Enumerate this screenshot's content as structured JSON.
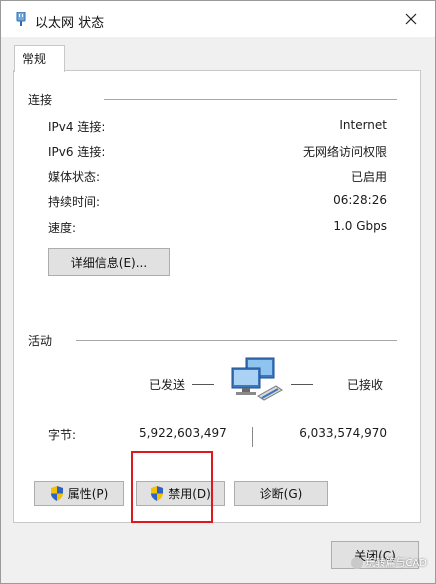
{
  "window": {
    "title": "以太网 状态"
  },
  "tabs": [
    {
      "label": "常规"
    }
  ],
  "connection": {
    "title": "连接",
    "rows": [
      {
        "label": "IPv4 连接:",
        "value": "Internet"
      },
      {
        "label": "IPv6 连接:",
        "value": "无网络访问权限"
      },
      {
        "label": "媒体状态:",
        "value": "已启用"
      },
      {
        "label": "持续时间:",
        "value": "06:28:26"
      },
      {
        "label": "速度:",
        "value": "1.0 Gbps"
      }
    ],
    "details_button": "详细信息(E)..."
  },
  "activity": {
    "title": "活动",
    "sent_label": "已发送",
    "received_label": "已接收",
    "bytes_label": "字节:",
    "bytes_sent": "5,922,603,497",
    "bytes_received": "6,033,574,970"
  },
  "buttons": {
    "properties": "属性(P)",
    "disable": "禁用(D)",
    "diagnose": "诊断(G)",
    "close": "关闭(C)"
  },
  "watermark": "玩转篇与CAD",
  "icons": [
    "network-adapter-icon",
    "close-x-icon",
    "shield-icon",
    "network-computers-icon"
  ],
  "colors": {
    "highlight_box": "#e0171e",
    "window_bg": "#f0f0f0",
    "panel_bg": "#ffffff"
  }
}
